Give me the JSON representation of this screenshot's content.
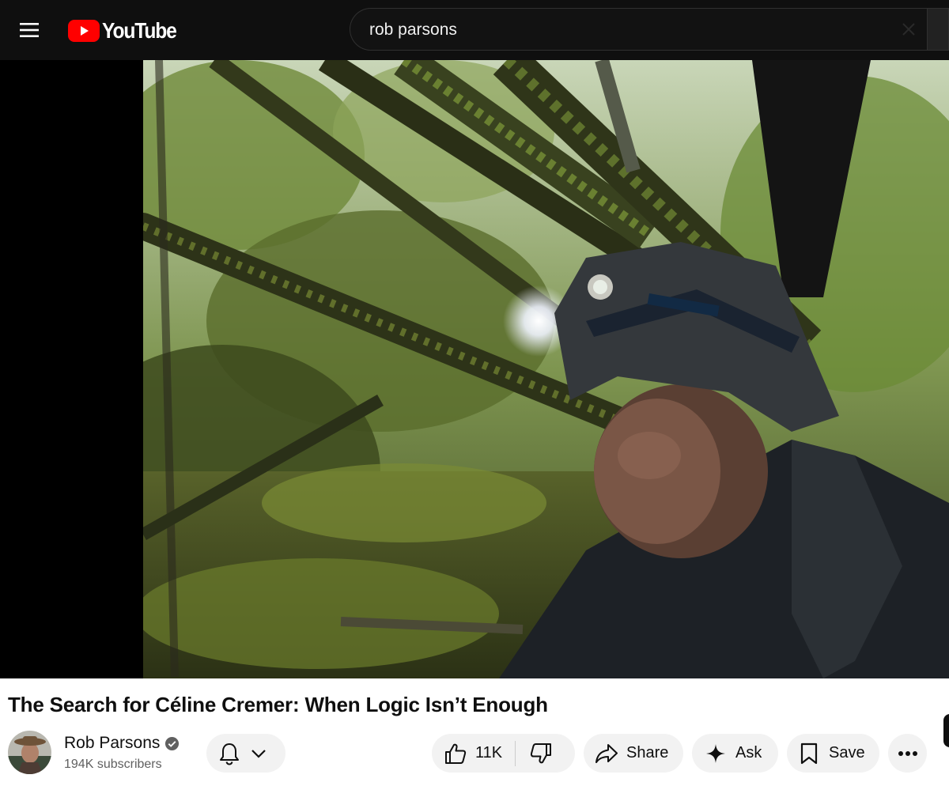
{
  "header": {
    "menu_icon": "hamburger-menu-icon",
    "logo_text": "YouTube",
    "brand_color": "#ff0000",
    "search": {
      "value": "rob parsons"
    }
  },
  "video": {
    "title": "The Search for Céline Cremer: When Logic Isn’t Enough",
    "frame_description_icon": "video-player"
  },
  "channel": {
    "name": "Rob Parsons",
    "subscribers": "194K subscribers",
    "verified": true
  },
  "actions": {
    "likes": "11K",
    "share_label": "Share",
    "ask_label": "Ask",
    "save_label": "Save"
  },
  "colors": {
    "topbar_bg": "#0f0f0f",
    "pill_bg": "#f2f2f2",
    "text_primary": "#0f0f0f",
    "text_secondary": "#606060"
  }
}
